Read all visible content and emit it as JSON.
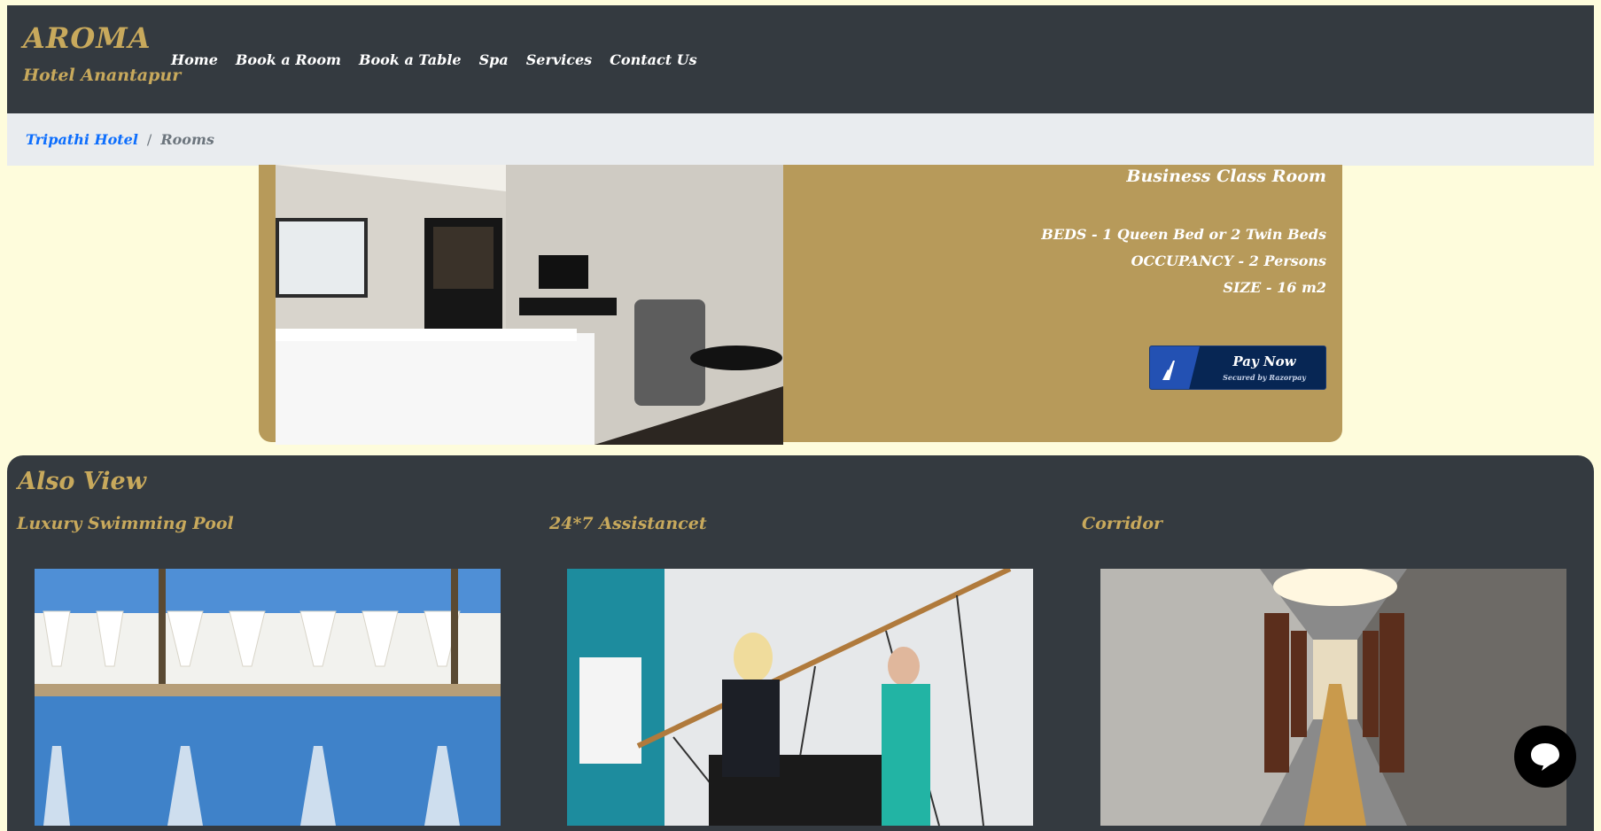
{
  "brand": {
    "title": "AROMA",
    "subtitle": "Hotel Anantapur"
  },
  "nav": {
    "links": [
      {
        "label": "Home"
      },
      {
        "label": "Book a Room"
      },
      {
        "label": "Book a Table"
      },
      {
        "label": "Spa"
      },
      {
        "label": "Services"
      },
      {
        "label": "Contact Us"
      }
    ]
  },
  "breadcrumb": {
    "home": "Tripathi Hotel",
    "separator": "/",
    "current": "Rooms"
  },
  "room": {
    "name": "Business Class Room",
    "beds": "BEDS - 1 Queen Bed or 2 Twin Beds",
    "occupancy": "OCCUPANCY - 2 Persons",
    "size": "SIZE - 16 m2",
    "pay_label": "Pay Now",
    "pay_sub": "Secured by Razorpay"
  },
  "also_view": {
    "title": "Also View",
    "items": [
      {
        "caption": "Luxury Swimming Pool"
      },
      {
        "caption": "24*7 Assistancet"
      },
      {
        "caption": "Corridor"
      }
    ]
  },
  "colors": {
    "navbar": "#343a40",
    "gold": "#c8a95c",
    "card": "#b79a5a",
    "page": "#fefcdc",
    "link": "#0d6efd"
  },
  "icons": [
    "razorpay-logo-icon",
    "chat-icon"
  ]
}
